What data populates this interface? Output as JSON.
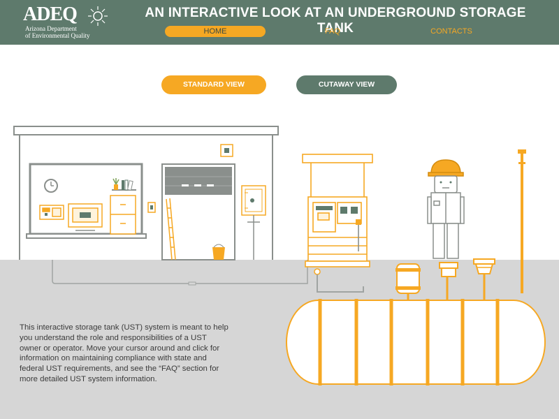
{
  "header": {
    "logo": {
      "mark": "ADEQ",
      "subtitle_line1": "Arizona Department",
      "subtitle_line2": "of Environmental Quality"
    },
    "title": "AN INTERACTIVE LOOK AT AN UNDERGROUND STORAGE TANK",
    "nav": {
      "home": "HOME",
      "faq": "FAQ",
      "contacts": "CONTACTS"
    }
  },
  "view_toggle": {
    "standard": "STANDARD VIEW",
    "cutaway": "CUTAWAY VIEW",
    "active": "standard"
  },
  "intro_text": "This interactive storage tank (UST) system is meant to help you understand the role and responsibilities of a UST owner or operator. Move your cursor around and click for information on maintaining compliance with state and federal UST requirements, and see the “FAQ” section for more detailed UST system information.",
  "colors": {
    "header": "#5e7a6c",
    "accent": "#f6a823",
    "line": "#8a8f8c",
    "ground": "#d6d6d6"
  }
}
